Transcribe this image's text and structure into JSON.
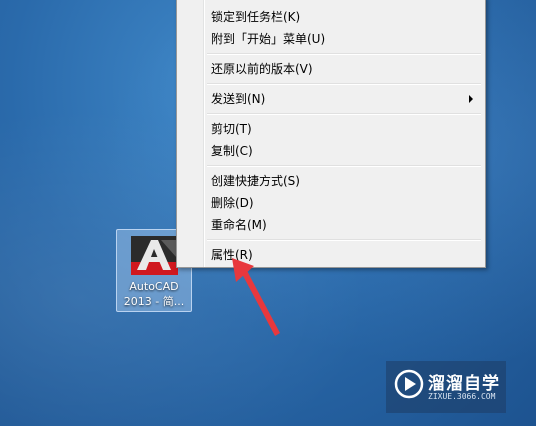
{
  "desktop": {
    "shortcut": {
      "label_line1": "AutoCAD",
      "label_line2": "2013 - 简...",
      "icon": "autocad-app-icon"
    }
  },
  "context_menu": {
    "items": [
      {
        "label": "锁定到任务栏(K)"
      },
      {
        "label": "附到「开始」菜单(U)"
      },
      {
        "label": "还原以前的版本(V)"
      },
      {
        "label": "发送到(N)",
        "has_submenu": true
      },
      {
        "label": "剪切(T)"
      },
      {
        "label": "复制(C)"
      },
      {
        "label": "创建快捷方式(S)"
      },
      {
        "label": "删除(D)"
      },
      {
        "label": "重命名(M)"
      },
      {
        "label": "属性(R)"
      }
    ]
  },
  "annotation": {
    "arrow_color": "#e8383d",
    "target": "属性(R)"
  },
  "watermark": {
    "brand": "溜溜自学",
    "url": "ZIXUE.3066.COM",
    "icon": "play-logo-icon"
  },
  "colors": {
    "desktop_blue": "#2a6aab",
    "menu_bg": "#f0f0f0"
  }
}
